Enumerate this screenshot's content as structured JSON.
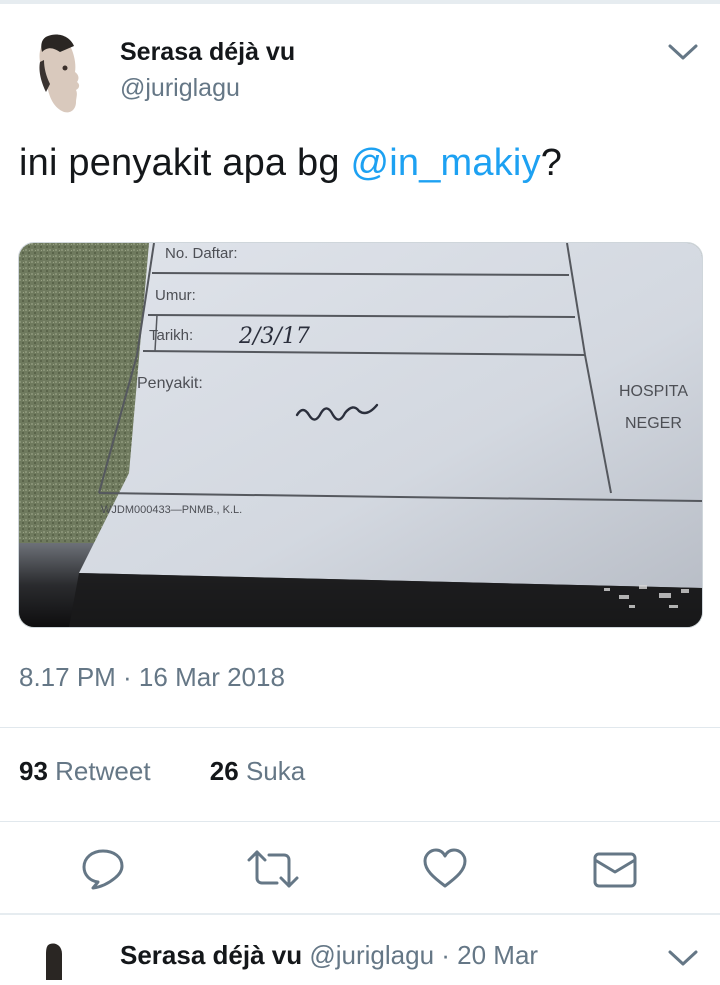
{
  "tweet": {
    "display_name": "Serasa déjà vu",
    "handle": "@juriglagu",
    "text_prefix": "ini penyakit apa bg ",
    "mention": "@in_makiy",
    "text_suffix": "?",
    "timestamp": "8.17 PM · 16 Mar 2018",
    "retweets_count": "93",
    "retweets_label": "Retweet",
    "likes_count": "26",
    "likes_label": "Suka"
  },
  "photo": {
    "no_daftar": "No. Daftar:",
    "umur": "Umur:",
    "tarikh": "Tarikh:",
    "tarikh_value": "2/3/17",
    "penyakit": "Penyakit:",
    "hospital_1": "HOSPITA",
    "hospital_2": "NEGER",
    "form_code": "WJDM000433—PNMB., K.L."
  },
  "next_tweet": {
    "display_name": "Serasa déjà vu",
    "handle": "@juriglagu",
    "date": "· 20 Mar"
  },
  "icons": {
    "reply": "speech-bubble-icon",
    "retweet": "retweet-arrows-icon",
    "like": "heart-icon",
    "share": "envelope-icon",
    "menu": "chevron-down-icon"
  },
  "colors": {
    "accent": "#1da1f2",
    "secondary_text": "#657786",
    "primary_text": "#14171a"
  }
}
